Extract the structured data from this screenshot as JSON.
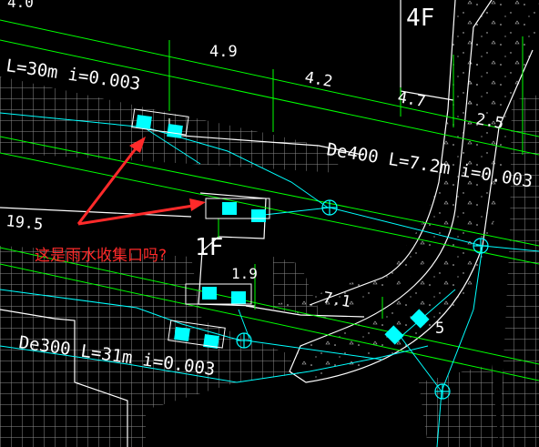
{
  "drawing": {
    "labels": {
      "floor_4f": "4F",
      "floor_1f": "1F",
      "dim_4_0": "4.0",
      "dim_4_9": "4.9",
      "dim_4_2": "4.2",
      "dim_4_7": "4.7",
      "dim_2_5": "2.5",
      "dim_19_5": "19.5",
      "dim_1_9": "1.9",
      "dim_7_1": "7.1",
      "dim_5": "5",
      "pipe_top": "L=30m i=0.003",
      "pipe_mid": "De400 L=7.2m i=0.003",
      "pipe_bottom": "De300 L=31m i=0.003"
    },
    "annotation": {
      "question": "这是雨水收集口吗?"
    },
    "colors": {
      "background": "#000000",
      "line_green": "#00ff00",
      "line_cyan": "#00ffff",
      "line_white": "#ffffff",
      "annotation_red": "#ff2a2a",
      "grid": "#8c8c8c"
    }
  }
}
